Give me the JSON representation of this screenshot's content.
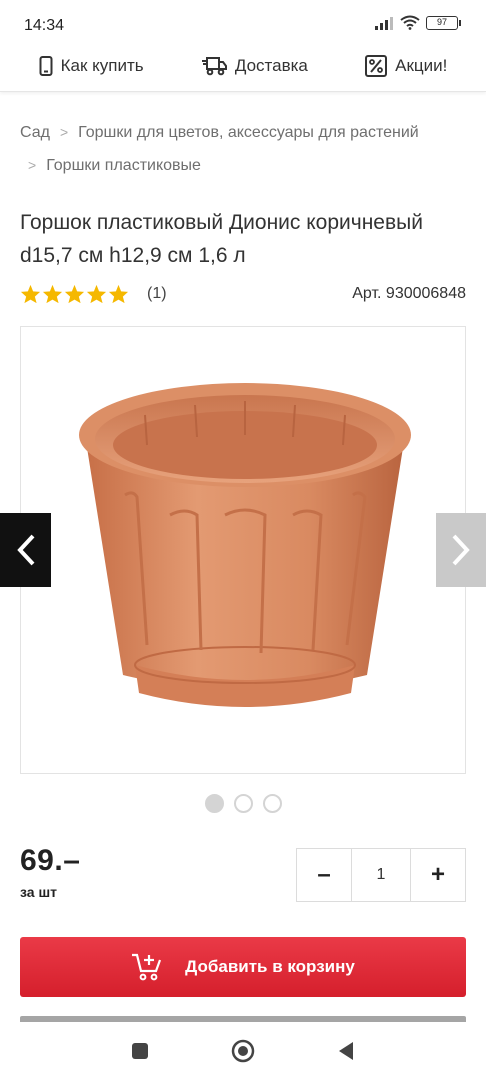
{
  "status_bar": {
    "time": "14:34",
    "battery": "97"
  },
  "top_nav": [
    {
      "label": "Как купить",
      "icon": "phone-icon"
    },
    {
      "label": "Доставка",
      "icon": "truck-icon"
    },
    {
      "label": "Акции!",
      "icon": "percent-icon"
    }
  ],
  "breadcrumb": [
    "Сад",
    "Горшки для цветов, аксессуары для растений",
    "Горшки пластиковые"
  ],
  "product": {
    "title": "Горшок пластиковый Дионис коричневый d15,7 см h12,9 см 1,6 л",
    "rating": 5,
    "review_count": "(1)",
    "article": "Арт. 930006848",
    "price": "69.–",
    "price_unit": "за шт"
  },
  "gallery": {
    "image": "brown-plastic-flower-pot",
    "slides": 3,
    "active_slide": 1
  },
  "quantity": {
    "minus": "–",
    "value": "1",
    "plus": "+"
  },
  "cart": {
    "add_label": "Добавить в корзину"
  },
  "colors": {
    "accent": "#e2303c",
    "star": "#f5b800",
    "pot": "#d6845a"
  }
}
